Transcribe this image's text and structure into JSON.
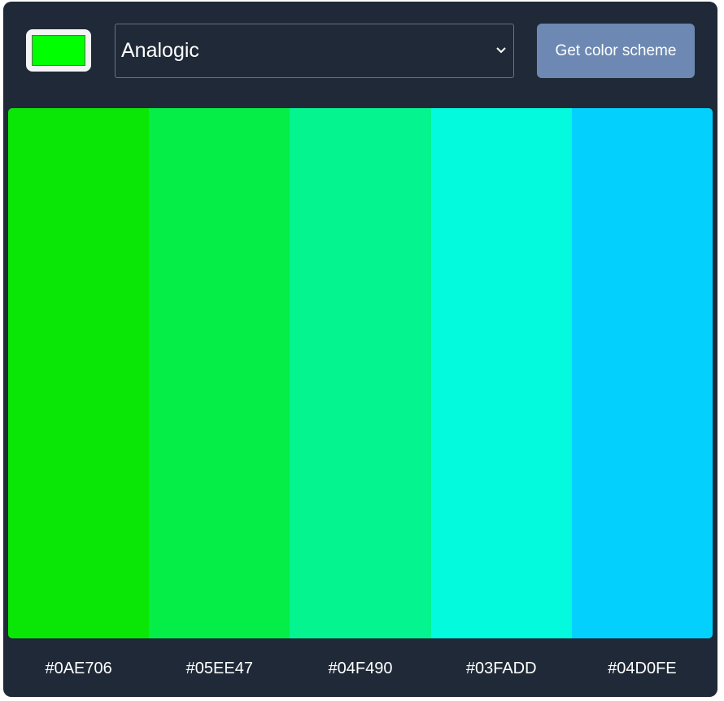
{
  "seed_color": "#00ff00",
  "mode_select": {
    "value": "Analogic"
  },
  "get_button": {
    "label": "Get color scheme"
  },
  "scheme": {
    "colors": [
      {
        "hex": "#0AE706",
        "color": "#0ae706"
      },
      {
        "hex": "#05EE47",
        "color": "#05ee47"
      },
      {
        "hex": "#04F490",
        "color": "#04f490"
      },
      {
        "hex": "#03FADD",
        "color": "#03fadd"
      },
      {
        "hex": "#04D0FE",
        "color": "#04d0fe"
      }
    ]
  },
  "colors": {
    "app_background": "#1f2937",
    "button_background": "#6d89b3"
  },
  "icons": {
    "select_arrow": "chevron-down-icon"
  }
}
